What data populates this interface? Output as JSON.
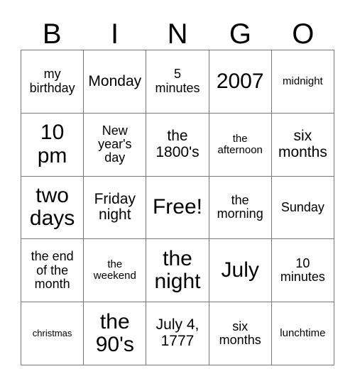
{
  "card": {
    "header_letters": [
      "B",
      "I",
      "N",
      "G",
      "O"
    ],
    "grid": {
      "rows": 5,
      "columns": 5,
      "border_color": "#777777",
      "background_color": "#ffffff",
      "text_color": "#000000"
    },
    "cells": [
      {
        "text": "my\nbirthday",
        "size": "m",
        "row": 1,
        "col": 1,
        "column_letter": "B",
        "free": false
      },
      {
        "text": "Monday",
        "size": "l",
        "row": 1,
        "col": 2,
        "column_letter": "I",
        "free": false
      },
      {
        "text": "5\nminutes",
        "size": "m",
        "row": 1,
        "col": 3,
        "column_letter": "N",
        "free": false
      },
      {
        "text": "2007",
        "size": "xxl",
        "row": 1,
        "col": 4,
        "column_letter": "G",
        "free": false
      },
      {
        "text": "midnight",
        "size": "s",
        "row": 1,
        "col": 5,
        "column_letter": "O",
        "free": false
      },
      {
        "text": "10\npm",
        "size": "xxl",
        "row": 2,
        "col": 1,
        "column_letter": "B",
        "free": false
      },
      {
        "text": "New\nyear's\nday",
        "size": "m",
        "row": 2,
        "col": 2,
        "column_letter": "I",
        "free": false
      },
      {
        "text": "the\n1800's",
        "size": "l",
        "row": 2,
        "col": 3,
        "column_letter": "N",
        "free": false
      },
      {
        "text": "the\nafternoon",
        "size": "s",
        "row": 2,
        "col": 4,
        "column_letter": "G",
        "free": false
      },
      {
        "text": "six\nmonths",
        "size": "l",
        "row": 2,
        "col": 5,
        "column_letter": "O",
        "free": false
      },
      {
        "text": "two\ndays",
        "size": "xxl",
        "row": 3,
        "col": 1,
        "column_letter": "B",
        "free": false
      },
      {
        "text": "Friday\nnight",
        "size": "l",
        "row": 3,
        "col": 2,
        "column_letter": "I",
        "free": false
      },
      {
        "text": "Free!",
        "size": "xxl",
        "row": 3,
        "col": 3,
        "column_letter": "N",
        "free": true
      },
      {
        "text": "the\nmorning",
        "size": "m",
        "row": 3,
        "col": 4,
        "column_letter": "G",
        "free": false
      },
      {
        "text": "Sunday",
        "size": "m",
        "row": 3,
        "col": 5,
        "column_letter": "O",
        "free": false
      },
      {
        "text": "the end\nof the\nmonth",
        "size": "m",
        "row": 4,
        "col": 1,
        "column_letter": "B",
        "free": false
      },
      {
        "text": "the\nweekend",
        "size": "s",
        "row": 4,
        "col": 2,
        "column_letter": "I",
        "free": false
      },
      {
        "text": "the\nnight",
        "size": "xxl",
        "row": 4,
        "col": 3,
        "column_letter": "N",
        "free": false
      },
      {
        "text": "July",
        "size": "xxl",
        "row": 4,
        "col": 4,
        "column_letter": "G",
        "free": false
      },
      {
        "text": "10\nminutes",
        "size": "m",
        "row": 4,
        "col": 5,
        "column_letter": "O",
        "free": false
      },
      {
        "text": "christmas",
        "size": "xs",
        "row": 5,
        "col": 1,
        "column_letter": "B",
        "free": false
      },
      {
        "text": "the\n90's",
        "size": "xxl",
        "row": 5,
        "col": 2,
        "column_letter": "I",
        "free": false
      },
      {
        "text": "July 4,\n1777",
        "size": "l",
        "row": 5,
        "col": 3,
        "column_letter": "N",
        "free": false
      },
      {
        "text": "six\nmonths",
        "size": "m",
        "row": 5,
        "col": 4,
        "column_letter": "G",
        "free": false
      },
      {
        "text": "lunchtime",
        "size": "s",
        "row": 5,
        "col": 5,
        "column_letter": "O",
        "free": false
      }
    ]
  }
}
